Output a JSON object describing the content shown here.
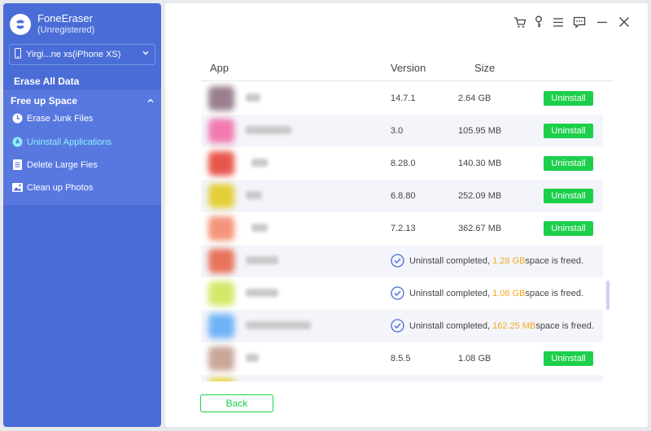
{
  "app": {
    "name": "FoneEraser",
    "status": "(Unregistered)"
  },
  "device": {
    "label": "Yirgi...ne xs(iPhone XS)"
  },
  "sidebar": {
    "erase_all": "Erase All Data",
    "free_up": "Free up Space",
    "items": [
      {
        "label": "Erase Junk Files",
        "icon": "clock-icon"
      },
      {
        "label": "Uninstall Applications",
        "icon": "app-store-icon",
        "active": true
      },
      {
        "label": "Delete Large Fies",
        "icon": "document-icon"
      },
      {
        "label": "Clean up Photos",
        "icon": "image-icon"
      }
    ]
  },
  "toolbar": {
    "icons": [
      "cart-icon",
      "key-icon",
      "menu-icon",
      "feedback-icon",
      "minimize-icon",
      "close-icon"
    ]
  },
  "table": {
    "columns": {
      "app": "App",
      "version": "Version",
      "size": "Size"
    },
    "uninstall_label": "Uninstall",
    "done_prefix": "Uninstall completed, ",
    "done_suffix": " space is freed.",
    "rows": [
      {
        "version": "14.7.1",
        "size": "2.64 GB",
        "status": "installed",
        "icon_color": "#9a7f8f"
      },
      {
        "version": "3.0",
        "size": "105.95 MB",
        "status": "installed",
        "icon_color": "#f07ab0"
      },
      {
        "version": "8.28.0",
        "size": "140.30 MB",
        "status": "installed",
        "icon_color": "#e8574c"
      },
      {
        "version": "6.8.80",
        "size": "252.09 MB",
        "status": "installed",
        "icon_color": "#e4cf3a"
      },
      {
        "version": "7.2.13",
        "size": "362.67 MB",
        "status": "installed",
        "icon_color": "#f4957a"
      },
      {
        "status": "removed",
        "freed": "1.28 GB",
        "icon_color": "#e8735b"
      },
      {
        "status": "removed",
        "freed": "1.08 GB",
        "icon_color": "#d6e86a"
      },
      {
        "status": "removed",
        "freed": "162.25 MB",
        "icon_color": "#6fb3f7"
      },
      {
        "version": "8.5.5",
        "size": "1.08 GB",
        "status": "installed",
        "icon_color": "#c9a79a"
      }
    ]
  },
  "back_label": "Back",
  "colors": {
    "accent": "#4a6cd6",
    "green": "#1ccf4a",
    "orange": "#f5a623"
  }
}
